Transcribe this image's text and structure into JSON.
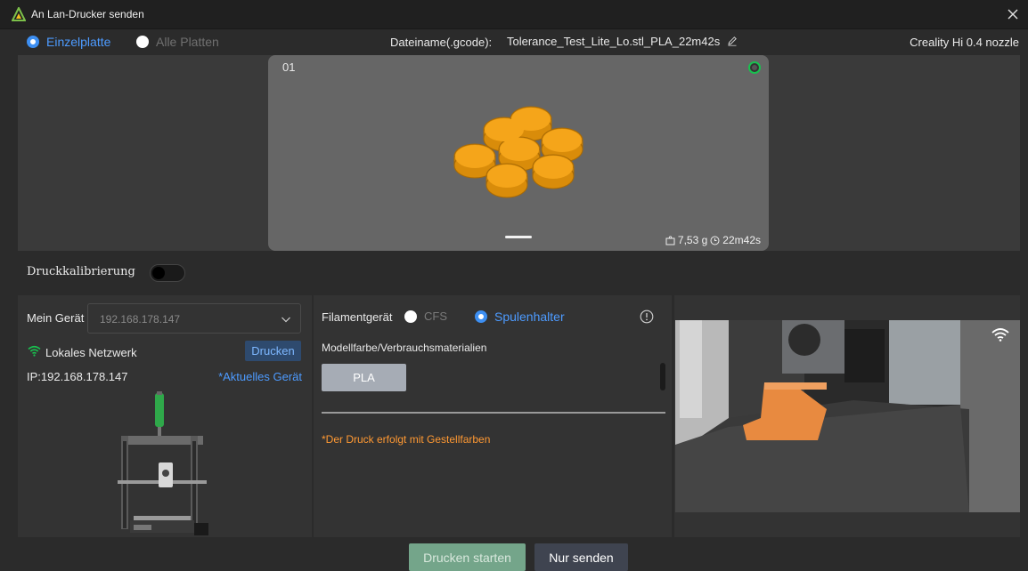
{
  "window": {
    "title": "An Lan-Drucker senden",
    "close_icon": "close-icon",
    "logo_icon": "creality-logo-icon"
  },
  "plate_select": {
    "single_label": "Einzelplatte",
    "all_label": "Alle Platten",
    "selected": "single"
  },
  "file": {
    "label": "Dateiname(.gcode):",
    "name": "Tolerance_Test_Lite_Lo.stl_PLA_22m42s"
  },
  "printer_profile": "Creality Hi 0.4 nozzle",
  "plate": {
    "number": "01",
    "weight": "7,53 g",
    "time": "22m42s"
  },
  "calibration": {
    "label": "Druckkalibrierung",
    "enabled": false
  },
  "device": {
    "label": "Mein Gerät",
    "selected_ip": "192.168.178.147",
    "network_label": "Lokales Netzwerk",
    "print_button": "Drucken",
    "ip_text": "IP:192.168.178.147",
    "current_link": "*Aktuelles Gerät"
  },
  "filament": {
    "device_label": "Filamentgerät",
    "cfs_label": "CFS",
    "spool_label": "Spulenhalter",
    "selected": "spool",
    "model_color_label": "Modellfarbe/Verbrauchsmaterialien",
    "material": "PLA",
    "note": "*Der Druck erfolgt mit Gestellfarben"
  },
  "footer": {
    "start_button": "Drucken starten",
    "send_button": "Nur senden"
  },
  "colors": {
    "accent": "#4d9bff",
    "success": "#19c04f",
    "warning": "#ff9933",
    "model": "#e89a10"
  }
}
